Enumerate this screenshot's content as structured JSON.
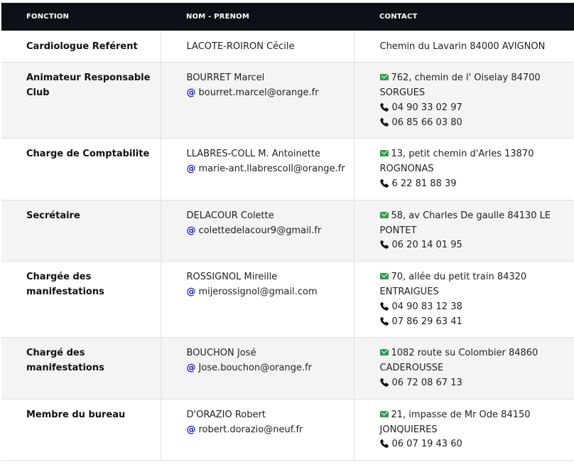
{
  "headers": {
    "fonction": "FONCTION",
    "nom_prenom": "NOM - PRENOM",
    "contact": "CONTACT"
  },
  "colors": {
    "header_bg": "#0d1117",
    "email_at": "#1a1acc",
    "envelope_icon": "#2e9e48",
    "phone_icon": "#111111"
  },
  "rows": [
    {
      "fonction": "Cardiologue Reférent",
      "name": "LACOTE-ROIRON Cécile",
      "email": "",
      "address": "Chemin du Lavarin 84000 AVIGNON",
      "address_icon": false,
      "phones": []
    },
    {
      "fonction": "Animateur Responsable Club",
      "name": "BOURRET Marcel",
      "email": "bourret.marcel@orange.fr",
      "address": "762, chemin de l' Oiselay 84700 SORGUES",
      "address_icon": true,
      "phones": [
        "04 90 33 02 97",
        "06 85 66 03 80"
      ]
    },
    {
      "fonction": "Charge de Comptabilite",
      "name": "LLABRES-COLL M. Antoinette",
      "email": "marie-ant.llabrescoll@orange.fr",
      "address": "13, petit chemin d'Arles 13870 ROGNONAS",
      "address_icon": true,
      "phones": [
        "6 22 81 88 39"
      ]
    },
    {
      "fonction": "Secrétaire",
      "name": "DELACOUR Colette",
      "email": "colettedelacour9@gmail.fr",
      "address": "58, av Charles De gaulle 84130 LE PONTET",
      "address_icon": true,
      "phones": [
        "06 20 14 01 95"
      ]
    },
    {
      "fonction": "Chargée des manifestations",
      "name": "ROSSIGNOL Mireille",
      "email": "mijerossignol@gmail.com",
      "address": "70, allée du petit train 84320 ENTRAIGUES",
      "address_icon": true,
      "phones": [
        "04 90 83 12 38",
        "07 86 29 63 41"
      ]
    },
    {
      "fonction": "Chargé des manifestations",
      "name": "BOUCHON José",
      "email": "Jose.bouchon@orange.fr",
      "address": "1082 route su Colombier 84860 CADEROUSSE",
      "address_icon": true,
      "phones": [
        "06 72 08 67 13"
      ]
    },
    {
      "fonction": "Membre du bureau",
      "name": "D'ORAZIO Robert",
      "email": "robert.dorazio@neuf.fr",
      "address": "21, impasse de Mr Ode 84150 JONQUIERES",
      "address_icon": true,
      "phones": [
        "06 07 19 43 60"
      ]
    }
  ]
}
